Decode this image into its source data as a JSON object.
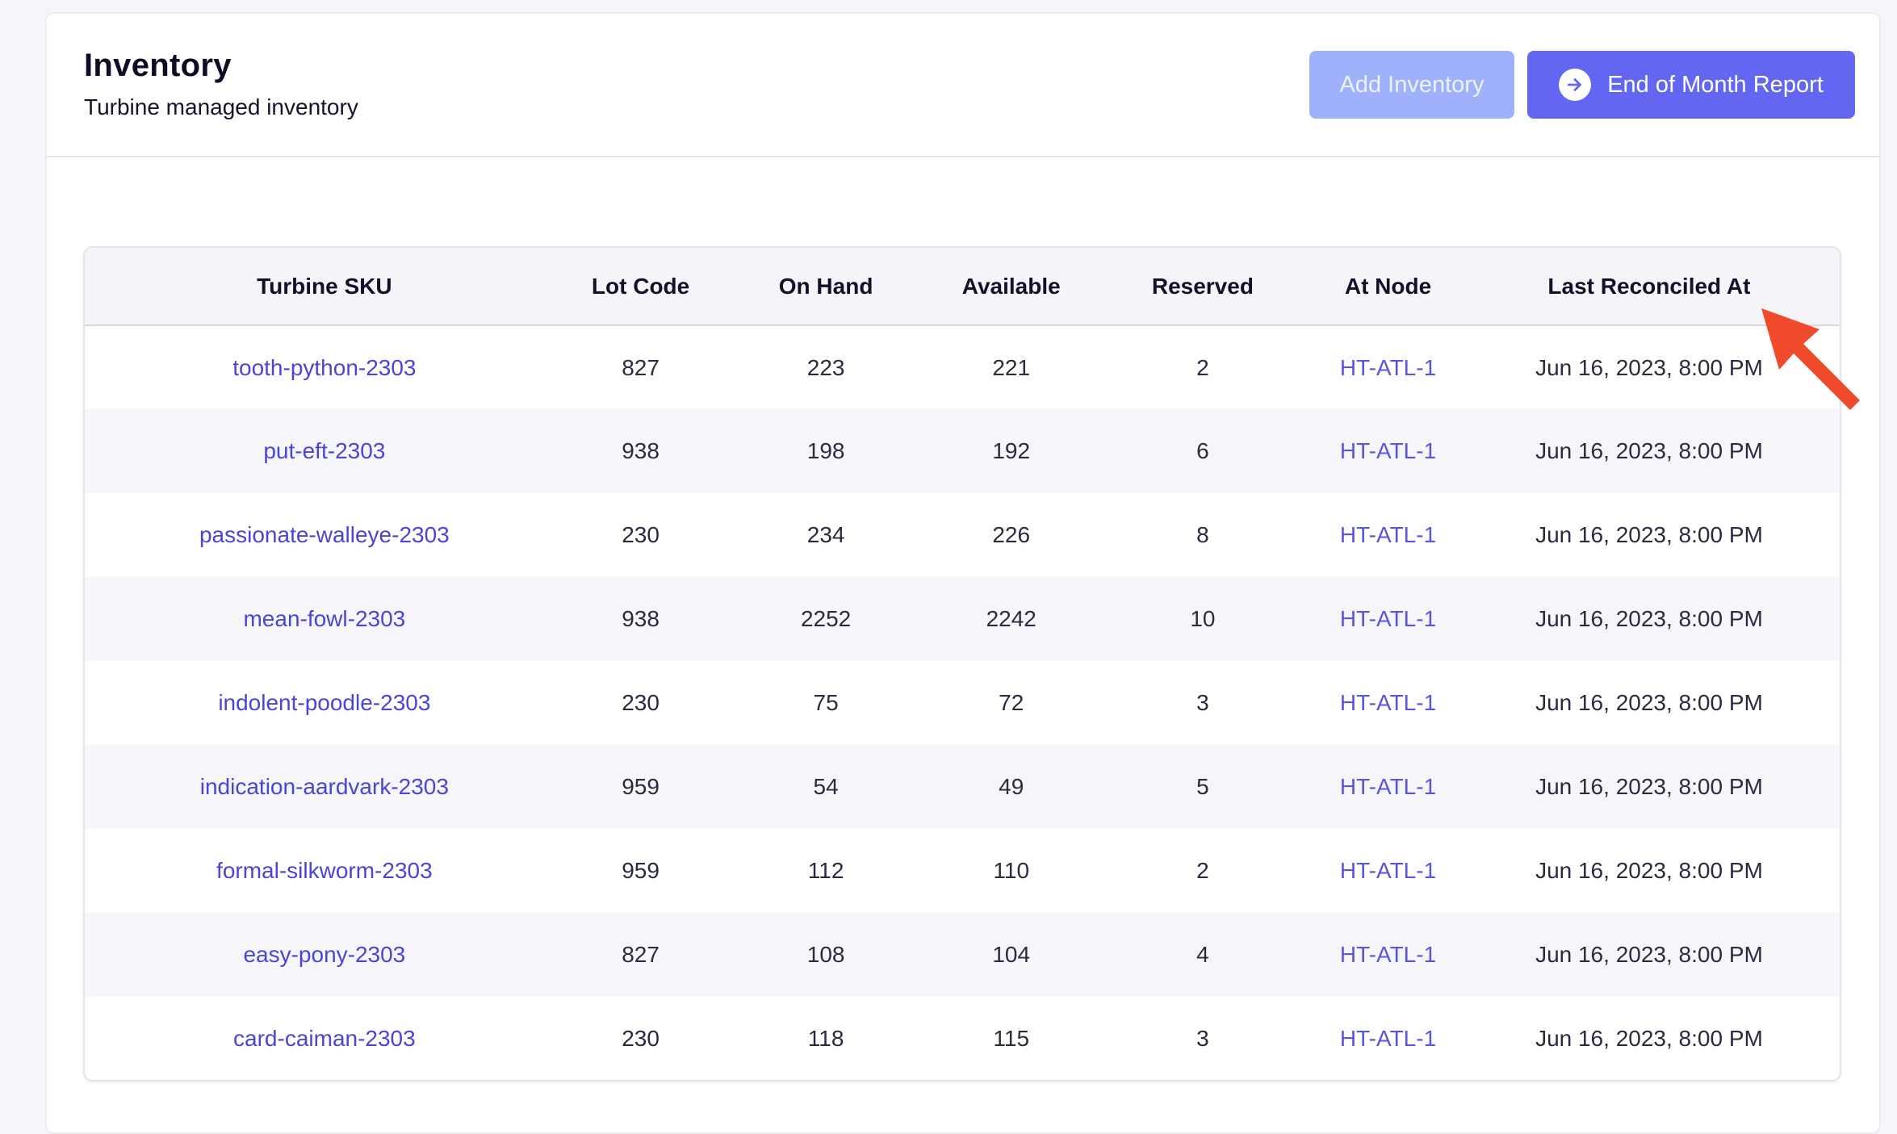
{
  "header": {
    "title": "Inventory",
    "subtitle": "Turbine managed inventory"
  },
  "actions": {
    "add_label": "Add Inventory",
    "report_label": "End of Month Report",
    "report_icon": "arrow-right-circle-icon"
  },
  "table": {
    "columns": [
      "Turbine SKU",
      "Lot Code",
      "On Hand",
      "Available",
      "Reserved",
      "At Node",
      "Last Reconciled At"
    ],
    "rows": [
      [
        "tooth-python-2303",
        "827",
        "223",
        "221",
        "2",
        "HT-ATL-1",
        "Jun 16, 2023, 8:00 PM"
      ],
      [
        "put-eft-2303",
        "938",
        "198",
        "192",
        "6",
        "HT-ATL-1",
        "Jun 16, 2023, 8:00 PM"
      ],
      [
        "passionate-walleye-2303",
        "230",
        "234",
        "226",
        "8",
        "HT-ATL-1",
        "Jun 16, 2023, 8:00 PM"
      ],
      [
        "mean-fowl-2303",
        "938",
        "2252",
        "2242",
        "10",
        "HT-ATL-1",
        "Jun 16, 2023, 8:00 PM"
      ],
      [
        "indolent-poodle-2303",
        "230",
        "75",
        "72",
        "3",
        "HT-ATL-1",
        "Jun 16, 2023, 8:00 PM"
      ],
      [
        "indication-aardvark-2303",
        "959",
        "54",
        "49",
        "5",
        "HT-ATL-1",
        "Jun 16, 2023, 8:00 PM"
      ],
      [
        "formal-silkworm-2303",
        "959",
        "112",
        "110",
        "2",
        "HT-ATL-1",
        "Jun 16, 2023, 8:00 PM"
      ],
      [
        "easy-pony-2303",
        "827",
        "108",
        "104",
        "4",
        "HT-ATL-1",
        "Jun 16, 2023, 8:00 PM"
      ],
      [
        "card-caiman-2303",
        "230",
        "118",
        "115",
        "3",
        "HT-ATL-1",
        "Jun 16, 2023, 8:00 PM"
      ]
    ]
  },
  "colors": {
    "accent": "#6366f1",
    "accent_light": "#9fb1fb",
    "link": "#4b44d9",
    "annotation_arrow": "#ee4a2b"
  }
}
